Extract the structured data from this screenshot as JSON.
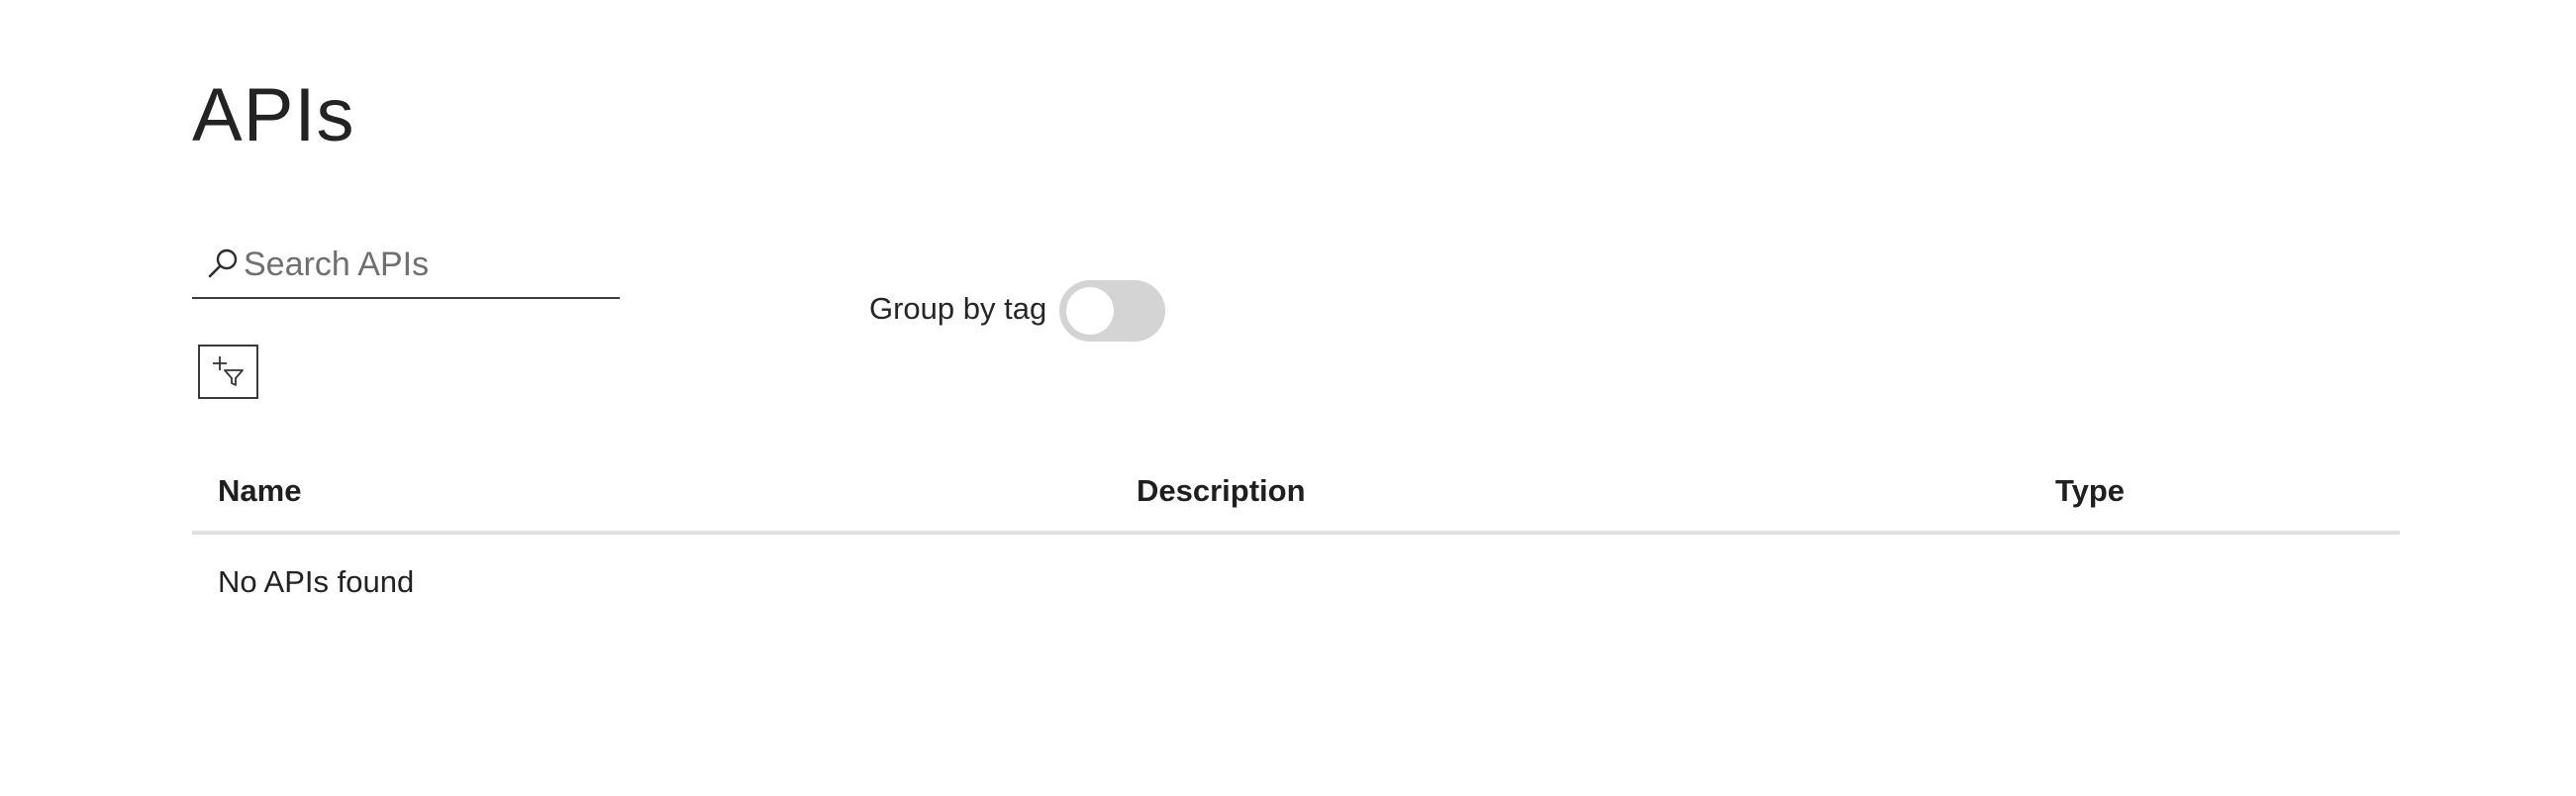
{
  "page": {
    "title": "APIs"
  },
  "search": {
    "placeholder": "Search APIs",
    "value": ""
  },
  "group_by_tag": {
    "label": "Group by tag",
    "enabled": false
  },
  "filter": {
    "icon": "add-filter-icon"
  },
  "table": {
    "columns": [
      "Name",
      "Description",
      "Type"
    ],
    "empty_message": "No APIs found"
  },
  "colors": {
    "text": "#222222",
    "toggle_off": "#d4d4d4",
    "divider": "#e0e0e0"
  }
}
